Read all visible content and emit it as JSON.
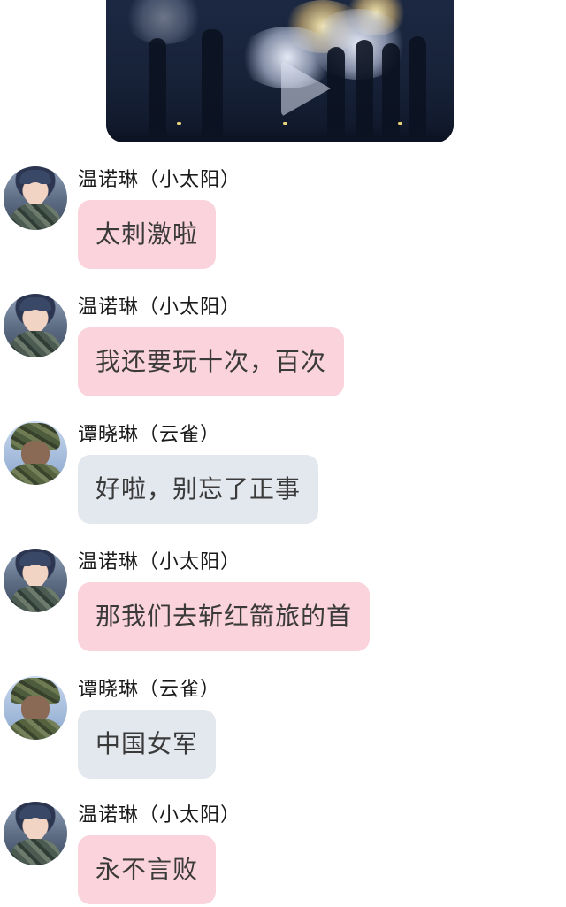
{
  "video": {
    "icon": "play-icon"
  },
  "messages": [
    {
      "sender": "温诺琳（小太阳）",
      "text": "太刺激啦",
      "bubble_color": "#fbd3dc",
      "avatar": "sun"
    },
    {
      "sender": "温诺琳（小太阳）",
      "text": "我还要玩十次，百次",
      "bubble_color": "#fbd3dc",
      "avatar": "sun"
    },
    {
      "sender": "谭晓琳（云雀）",
      "text": "好啦，别忘了正事",
      "bubble_color": "#e3e7ee",
      "avatar": "lark"
    },
    {
      "sender": "温诺琳（小太阳）",
      "text": "那我们去斩红箭旅的首",
      "bubble_color": "#fbd3dc",
      "avatar": "sun"
    },
    {
      "sender": "谭晓琳（云雀）",
      "text": "中国女军",
      "bubble_color": "#e3e7ee",
      "avatar": "lark"
    },
    {
      "sender": "温诺琳（小太阳）",
      "text": "永不言败",
      "bubble_color": "#fbd3dc",
      "avatar": "sun"
    }
  ]
}
